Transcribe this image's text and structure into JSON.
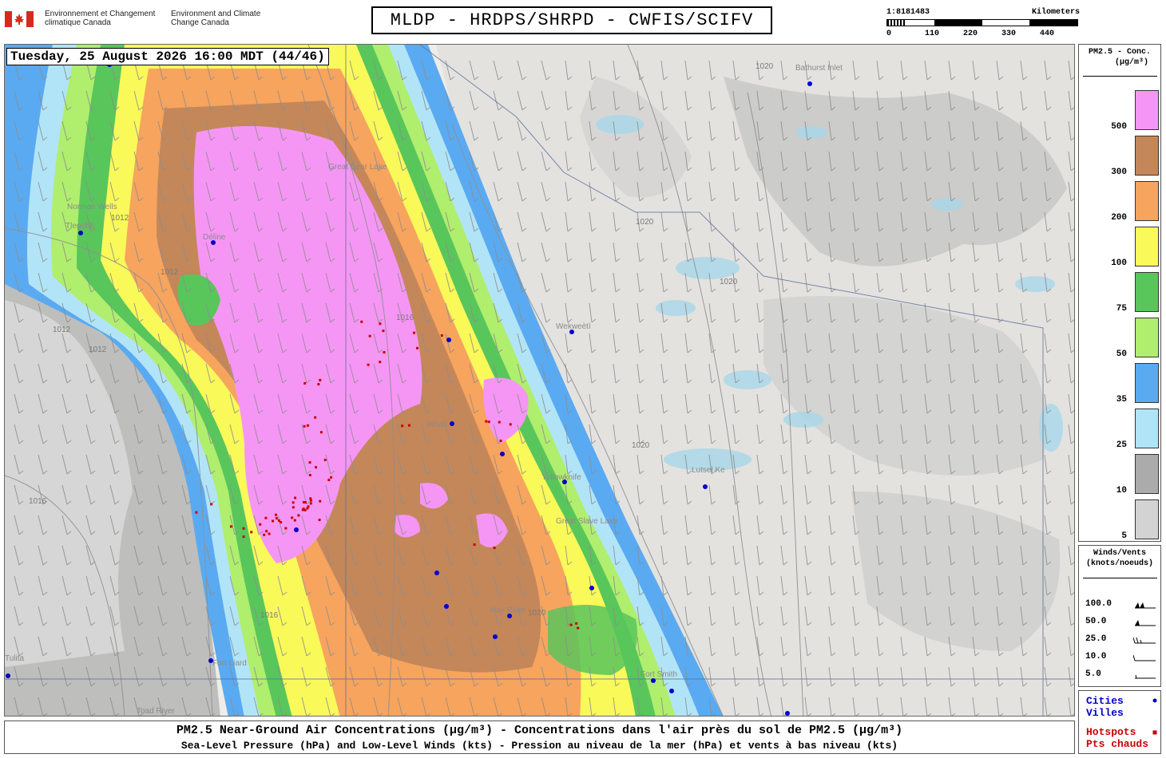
{
  "header": {
    "dept_fr": "Environnement et Changement climatique Canada",
    "dept_en": "Environment and Climate Change Canada",
    "title": "MLDP - HRDPS/SHRPD - CWFIS/SCIFV",
    "scale_ratio": "1:8181483",
    "scale_units": "Kilometers",
    "scale_ticks": [
      "0",
      "110",
      "220",
      "330",
      "440"
    ]
  },
  "map": {
    "timestamp": "Tuesday, 25 August 2026 16:00 MDT (44/46)",
    "places": [
      "Bathurst Inlet",
      "Norman Wells",
      "Tlegohli",
      "Déline",
      "Great Bear Lake",
      "Wekweètì",
      "Whatì",
      "Yellowknife",
      "Lutsel Ke",
      "Hay River",
      "Fort Smith",
      "Fort Liard",
      "Toad River",
      "Tulita",
      "Great Slave Lake"
    ],
    "isobars": [
      "1020",
      "1016",
      "1012"
    ]
  },
  "legend": {
    "title_line1": "PM2.5 - Conc.",
    "title_line2": "(µg/m³)",
    "bins": [
      {
        "label": "500",
        "color": "#f596f5"
      },
      {
        "label": "300",
        "color": "#c4875a"
      },
      {
        "label": "200",
        "color": "#f7a45e"
      },
      {
        "label": "100",
        "color": "#f9f95a"
      },
      {
        "label": "75",
        "color": "#59c65c"
      },
      {
        "label": "50",
        "color": "#b0ee6e"
      },
      {
        "label": "35",
        "color": "#5aaaf2"
      },
      {
        "label": "25",
        "color": "#b2e4f7"
      },
      {
        "label": "10",
        "color": "#ababab"
      },
      {
        "label": "5",
        "color": "#d3d3d3"
      }
    ]
  },
  "winds": {
    "title_line1": "Winds/Vents",
    "title_line2": "(knots/noeuds)",
    "rows": [
      "100.0",
      "50.0",
      "25.0",
      "10.0",
      "5.0"
    ]
  },
  "markers": {
    "cities_en": "Cities",
    "cities_fr": "Villes",
    "cities_color": "#0000cc",
    "hotspots_en": "Hotspots",
    "hotspots_fr": "Pts chauds",
    "hotspots_color": "#cc0000"
  },
  "footer": {
    "line1": "PM2.5 Near-Ground Air Concentrations (µg/m³) - Concentrations dans l'air près du sol de PM2.5 (µg/m³)",
    "line2": "Sea-Level Pressure (hPa) and Low-Level Winds (kts) - Pression au niveau de la mer (hPa) et vents à bas niveau (kts)"
  }
}
